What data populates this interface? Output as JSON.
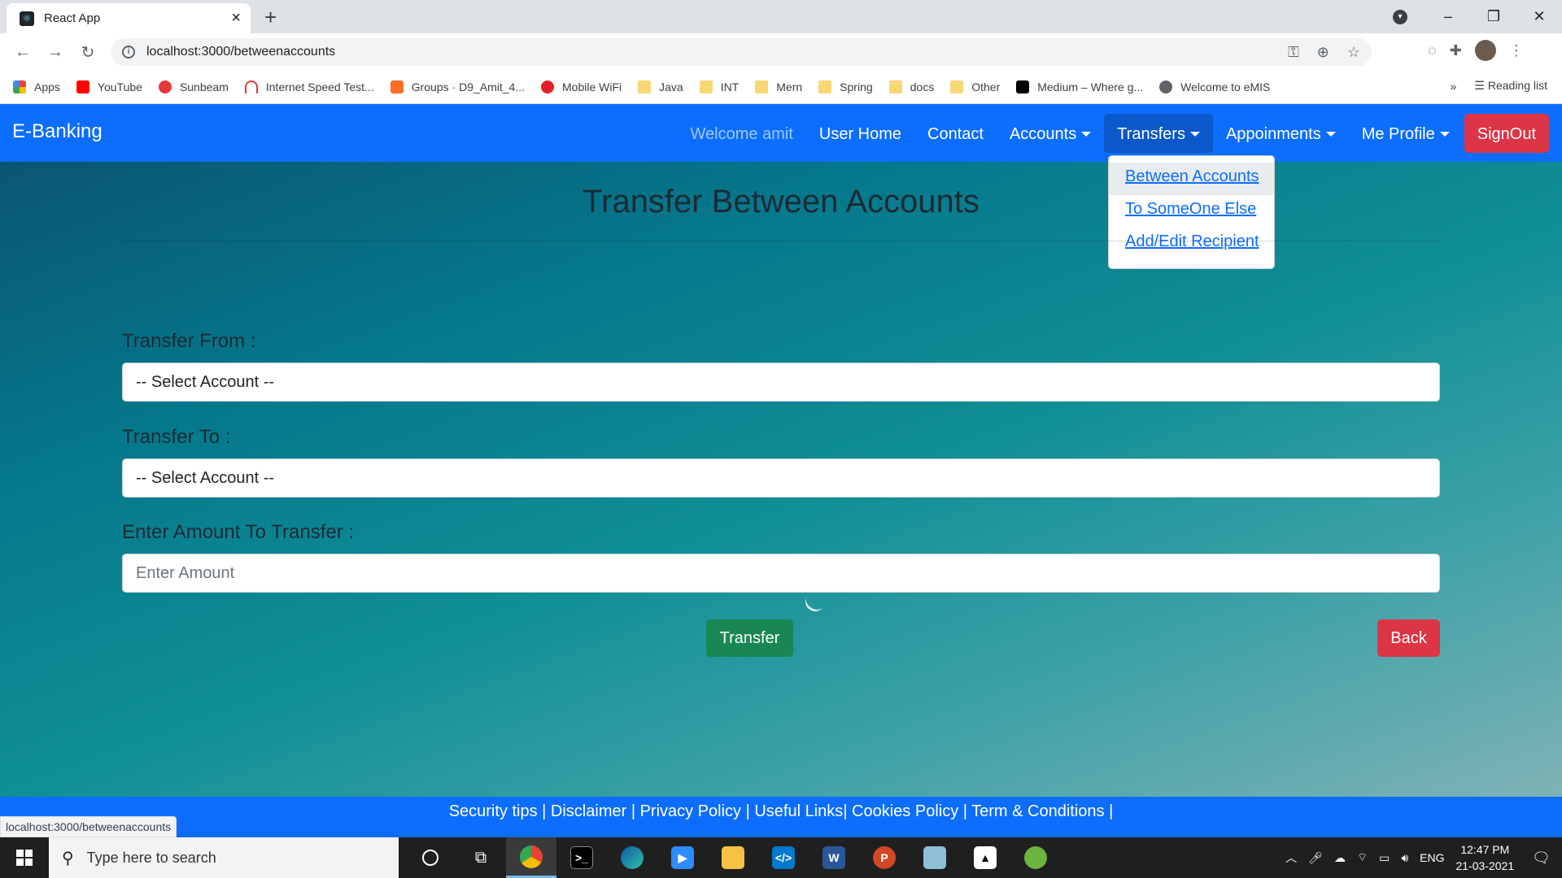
{
  "browser": {
    "tab_title": "React App",
    "url": "localhost:3000/betweenaccounts",
    "bookmarks": [
      "Apps",
      "YouTube",
      "Sunbeam",
      "Internet Speed Test...",
      "Groups · D9_Amit_4...",
      "Mobile WiFi",
      "Java",
      "INT",
      "Mern",
      "Spring",
      "docs",
      "Other",
      "Medium – Where g...",
      "Welcome to eMIS"
    ],
    "reading_list": "Reading list",
    "more_bookmarks": "»",
    "status_url": "localhost:3000/betweenaccounts"
  },
  "nav": {
    "brand": "E-Banking",
    "welcome": "Welcome amit",
    "user_home": "User Home",
    "contact": "Contact",
    "accounts": "Accounts",
    "transfers": "Transfers",
    "appoinments": "Appoinments",
    "me_profile": "Me Profile",
    "signout": "SignOut"
  },
  "dropdown": {
    "items": [
      "Between Accounts",
      "To SomeOne Else",
      "Add/Edit Recipient"
    ]
  },
  "form": {
    "title": "Transfer Between Accounts",
    "from_label": "Transfer From :",
    "from_value": "-- Select Account --",
    "to_label": "Transfer To :",
    "to_value": "-- Select Account --",
    "amount_label": "Enter Amount To Transfer :",
    "amount_placeholder": "Enter Amount",
    "transfer_button": "Transfer",
    "back_button": "Back"
  },
  "footer": {
    "links": "Security tips | Disclaimer | Privacy Policy | Useful Links| Cookies Policy | Term & Conditions |"
  },
  "taskbar": {
    "search_placeholder": "Type here to search",
    "language": "ENG",
    "time": "12:47 PM",
    "date": "21-03-2021"
  },
  "colors": {
    "navbar": "#0d6efd",
    "signout": "#dc3545",
    "transfer": "#198754",
    "back": "#dc3545"
  }
}
